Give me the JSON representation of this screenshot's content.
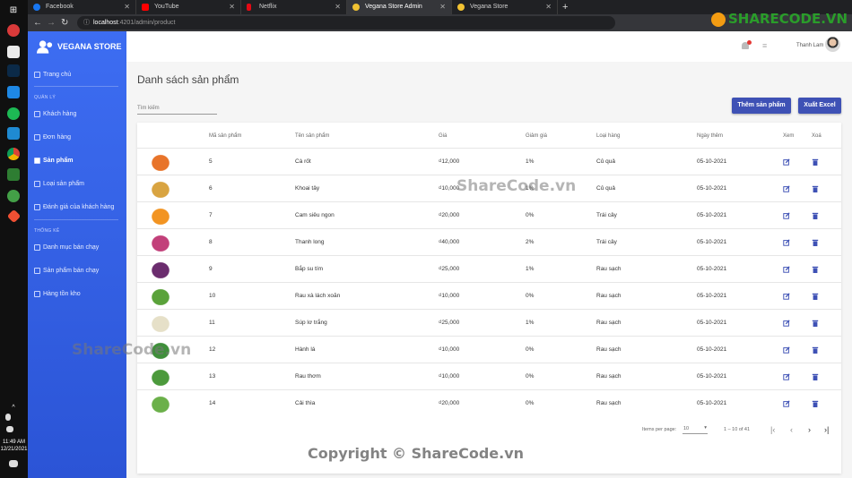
{
  "taskbar": {
    "time": "11:49 AM",
    "date": "12/21/2021"
  },
  "browser": {
    "tabs": [
      {
        "label": "Facebook",
        "color": "#1877f2"
      },
      {
        "label": "YouTube",
        "color": "#ff0000"
      },
      {
        "label": "Netflix",
        "color": "#e50914"
      },
      {
        "label": "Vegana Store Admin",
        "color": "#f1c232",
        "active": true
      },
      {
        "label": "Vegana Store",
        "color": "#f1c232"
      }
    ],
    "url_host": "localhost",
    "url_rest": ":4201/admin/product"
  },
  "sidebar": {
    "brand": "VEGANA STORE",
    "home": "Trang chủ",
    "section_manage": "QUẢN LÝ",
    "items": [
      "Khách hàng",
      "Đơn hàng",
      "Sản phẩm",
      "Loại sản phẩm",
      "Đánh giá của khách hàng"
    ],
    "section_stats": "THỐNG KÊ",
    "stats": [
      "Danh mục bán chạy",
      "Sản phẩm bán chạy",
      "Hàng tồn kho"
    ]
  },
  "topbar": {
    "user": "Thanh Lam"
  },
  "main": {
    "title": "Danh sách sản phẩm",
    "search_placeholder": "Tìm kiếm",
    "add_button": "Thêm sản phẩm",
    "export_button": "Xuất Excel",
    "columns": [
      "Mã sản phẩm",
      "Tên sản phẩm",
      "Giá",
      "Giảm giá",
      "Loại hàng",
      "Ngày thêm",
      "Xem",
      "Xoá"
    ],
    "rows": [
      {
        "id": "5",
        "name": "Cà rốt",
        "price": "₫12,000",
        "discount": "1%",
        "type": "Củ quả",
        "date": "05-10-2021",
        "color": "#e8742a"
      },
      {
        "id": "6",
        "name": "Khoai tây",
        "price": "₫10,000",
        "discount": "1%",
        "type": "Củ quả",
        "date": "05-10-2021",
        "color": "#d9a441"
      },
      {
        "id": "7",
        "name": "Cam siêu ngon",
        "price": "₫20,000",
        "discount": "0%",
        "type": "Trái cây",
        "date": "05-10-2021",
        "color": "#f29422"
      },
      {
        "id": "8",
        "name": "Thanh long",
        "price": "₫40,000",
        "discount": "2%",
        "type": "Trái cây",
        "date": "05-10-2021",
        "color": "#c2407a"
      },
      {
        "id": "9",
        "name": "Bắp su tím",
        "price": "₫25,000",
        "discount": "1%",
        "type": "Rau sạch",
        "date": "05-10-2021",
        "color": "#6b2d6e"
      },
      {
        "id": "10",
        "name": "Rau xà lách xoăn",
        "price": "₫10,000",
        "discount": "0%",
        "type": "Rau sạch",
        "date": "05-10-2021",
        "color": "#5aa23a"
      },
      {
        "id": "11",
        "name": "Súp lơ trắng",
        "price": "₫25,000",
        "discount": "1%",
        "type": "Rau sạch",
        "date": "05-10-2021",
        "color": "#e6e0c8"
      },
      {
        "id": "12",
        "name": "Hành lá",
        "price": "₫10,000",
        "discount": "0%",
        "type": "Rau sạch",
        "date": "05-10-2021",
        "color": "#3f8f3a"
      },
      {
        "id": "13",
        "name": "Rau thơm",
        "price": "₫10,000",
        "discount": "0%",
        "type": "Rau sạch",
        "date": "05-10-2021",
        "color": "#4c9a3c"
      },
      {
        "id": "14",
        "name": "Cải thìa",
        "price": "₫20,000",
        "discount": "0%",
        "type": "Rau sạch",
        "date": "05-10-2021",
        "color": "#6bb04a"
      }
    ],
    "paginator": {
      "label": "Items per page:",
      "size": "10",
      "range": "1 – 10 of 41"
    }
  },
  "watermarks": {
    "center": "ShareCode.vn",
    "left": "ShareCode.vn",
    "copyright": "Copyright © ShareCode.vn",
    "logo": "SHARECODE.VN"
  },
  "colors": {
    "sidebar": "#3d6df2",
    "button": "#3e51b5",
    "icon": "#3e51b5"
  }
}
